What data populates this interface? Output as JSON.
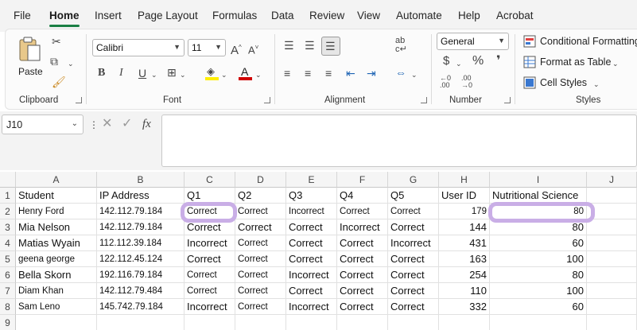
{
  "menu": {
    "tabs": [
      "File",
      "Home",
      "Insert",
      "Page Layout",
      "Formulas",
      "Data",
      "Review",
      "View",
      "Automate",
      "Help",
      "Acrobat"
    ],
    "active": "Home"
  },
  "ribbon": {
    "clipboard": {
      "label": "Clipboard",
      "paste_label": "Paste"
    },
    "font": {
      "label": "Font",
      "font_name": "Calibri",
      "font_size": "11"
    },
    "alignment": {
      "label": "Alignment"
    },
    "number": {
      "label": "Number",
      "format": "General"
    },
    "styles": {
      "label": "Styles",
      "conditional_formatting": "Conditional Formatting",
      "format_as_table": "Format as Table",
      "cell_styles": "Cell Styles"
    }
  },
  "formula_bar": {
    "name_box": "J10",
    "fx": "fx",
    "formula": ""
  },
  "sheet": {
    "columns": [
      "A",
      "B",
      "C",
      "D",
      "E",
      "F",
      "G",
      "H",
      "I",
      "J"
    ],
    "rows": [
      "1",
      "2",
      "3",
      "4",
      "5",
      "6",
      "7",
      "8",
      "9"
    ],
    "data": [
      [
        "Student",
        "IP Address",
        "Q1",
        "Q2",
        "Q3",
        "Q4",
        "Q5",
        "User ID",
        "Nutritional Science",
        ""
      ],
      [
        "Henry Ford",
        "142.112.79.184",
        "Correct",
        "Correct",
        "Incorrect",
        "Correct",
        "Correct",
        "179",
        "80",
        ""
      ],
      [
        "Mia Nelson",
        "142.112.79.184",
        "Correct",
        "Correct",
        "Correct",
        "Incorrect",
        "Correct",
        "144",
        "80",
        ""
      ],
      [
        "Matias Wyain",
        "112.112.39.184",
        "Incorrect",
        "Correct",
        "Correct",
        "Correct",
        "Incorrect",
        "431",
        "60",
        ""
      ],
      [
        "geena george",
        "122.112.45.124",
        "Correct",
        "Correct",
        "Correct",
        "Correct",
        "Correct",
        "163",
        "100",
        ""
      ],
      [
        "Bella Skorn",
        "192.116.79.184",
        "Correct",
        "Correct",
        "Incorrect",
        "Correct",
        "Correct",
        "254",
        "80",
        ""
      ],
      [
        "Diam Khan",
        "142.112.79.484",
        "Correct",
        "Correct",
        "Correct",
        "Correct",
        "Correct",
        "110",
        "100",
        ""
      ],
      [
        "Sam Leno",
        "145.742.79.184",
        "Incorrect",
        "Correct",
        "Incorrect",
        "Correct",
        "Correct",
        "332",
        "60",
        ""
      ],
      [
        "",
        "",
        "",
        "",
        "",
        "",
        "",
        "",
        "",
        ""
      ]
    ]
  },
  "colors": {
    "accent": "#1a7f44",
    "highlight": "#c9aee6"
  }
}
